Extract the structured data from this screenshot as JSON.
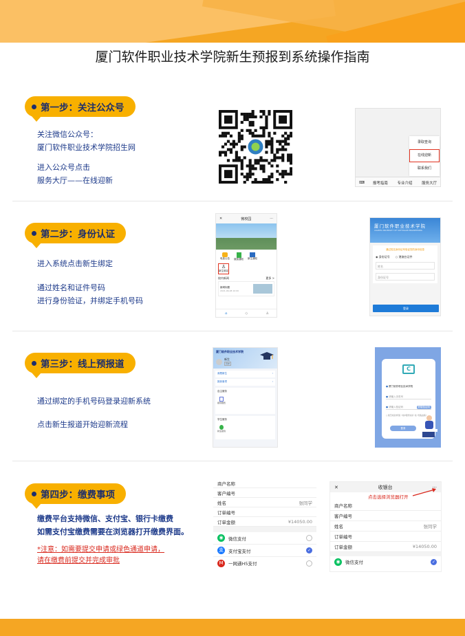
{
  "title": "厦门软件职业技术学院新生预报到系统操作指南",
  "colors": {
    "accent": "#f8b000",
    "text": "#1d3a8a",
    "warning": "#d9281d",
    "wechat_green": "#07c160",
    "blue": "#1e7bd8"
  },
  "step1": {
    "label": "第一步：关注公众号",
    "lines": [
      "关注微信公众号：",
      "厦门软件职业技术学院招生网",
      "进入公众号点击",
      "服务大厅——在线迎新"
    ],
    "menu": {
      "items": [
        "录取查询",
        "在线迎新",
        "联系我们"
      ],
      "tabs": [
        "报考指南",
        "专业介绍",
        "服务大厅"
      ]
    }
  },
  "step2": {
    "label": "第二步：身份认证",
    "lines": [
      "进入系统点击新生绑定",
      "通过姓名和证件号码",
      "进行身份验证，并绑定手机号码"
    ],
    "phone_a": {
      "title": "微校园",
      "icons": [
        "电费公告",
        "缴费通知",
        "新生通知"
      ],
      "bind": "新生绑定",
      "news_title": "校内新闻",
      "news_more": "更多 >",
      "news_item": "新闻标题",
      "news_date": "2021-06-08 10:00"
    },
    "phone_b": {
      "school": "厦门软件职业技术学院",
      "school_en": "XIAMEN UNIVERSITY OF SOFTWARE ENGINEERING",
      "notice": "通过姓名身份证号验证您的身份信息",
      "radio1": "身份证号",
      "radio2": "港澳台证件",
      "field1": "姓名",
      "field2": "身份证号",
      "button": "登录"
    }
  },
  "step3": {
    "label": "第三步：线上预报道",
    "lines": [
      "通过绑定的手机号码登录迎新系统",
      "点击新生报道开始迎新流程"
    ],
    "phone_a": {
      "school": "厦门软件职业技术学院",
      "user": "新生",
      "user_tag": "同学",
      "menu1": "我是新生",
      "menu2": "报到事项",
      "sec1": "自主服务",
      "sec1_item": "报到缴费",
      "sec2": "学生服务",
      "sec2_item": "新生报到"
    },
    "phone_b": {
      "logo": "C",
      "school": "厦门软件职业技术学院",
      "f1": "请输入手机号",
      "f2": "请输入验证码",
      "f2_btn": "获取验证码",
      "agree": "我已阅读并同意《用户服务协议》和《隐私政策》",
      "button": "登录"
    }
  },
  "step4": {
    "label": "第四步：缴费事项",
    "lines": [
      "缴费平台支持微信、支付宝、银行卡缴费",
      "如需支付宝缴费需要在浏览器打开缴费界面。"
    ],
    "note_lines": [
      "*注意：如需要提交申请或绿色通道申请，",
      "请在缴费前提交并完成审批"
    ],
    "left_panel": {
      "rows": [
        {
          "k": "商户名称",
          "v": ""
        },
        {
          "k": "客户编号",
          "v": ""
        },
        {
          "k": "姓名",
          "v": "张同学"
        },
        {
          "k": "订单编号",
          "v": ""
        },
        {
          "k": "订单金额",
          "v": "¥14050.00"
        }
      ],
      "pays": [
        "微信支付",
        "支付宝支付",
        "一网通H5支付"
      ]
    },
    "right_panel": {
      "close": "✕",
      "title": "收银台",
      "more": "···",
      "hint": "点击选择浏览器打开",
      "rows": [
        {
          "k": "商户名称",
          "v": ""
        },
        {
          "k": "客户编号",
          "v": ""
        },
        {
          "k": "姓名",
          "v": "张同学"
        },
        {
          "k": "订单编号",
          "v": ""
        },
        {
          "k": "订单金额",
          "v": "¥14050.00"
        }
      ],
      "pay": "微信支付"
    }
  }
}
